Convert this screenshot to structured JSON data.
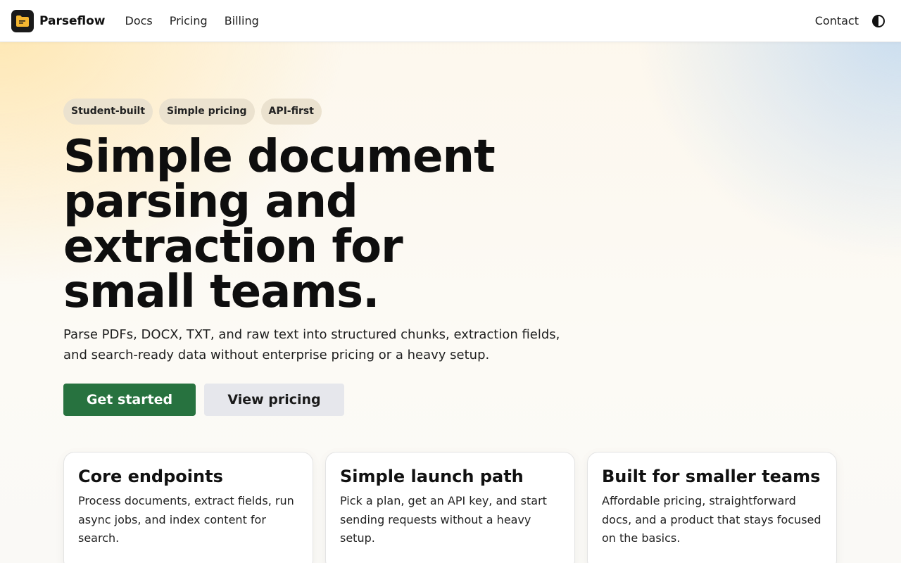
{
  "nav": {
    "brand": "Parseflow",
    "links": [
      "Docs",
      "Pricing",
      "Billing"
    ],
    "contact": "Contact",
    "logo_icon": "folder-icon",
    "theme_icon": "contrast-icon"
  },
  "hero": {
    "badges": [
      "Student-built",
      "Simple pricing",
      "API-first"
    ],
    "headline": "Simple document parsing and extraction for small teams.",
    "subtext": "Parse PDFs, DOCX, TXT, and raw text into structured chunks, extraction fields, and search-ready data without enterprise pricing or a heavy setup.",
    "primary_cta": "Get started",
    "secondary_cta": "View pricing"
  },
  "cards": [
    {
      "title": "Core endpoints",
      "body": "Process documents, extract fields, run async jobs, and index content for search."
    },
    {
      "title": "Simple launch path",
      "body": "Pick a plan, get an API key, and start sending requests without a heavy setup."
    },
    {
      "title": "Built for smaller teams",
      "body": "Affordable pricing, straightforward docs, and a product that stays focused on the basics."
    }
  ],
  "colors": {
    "accent": "#27723f",
    "logo_fill": "#f5b731",
    "badge_bg": "#ebe2cf"
  }
}
